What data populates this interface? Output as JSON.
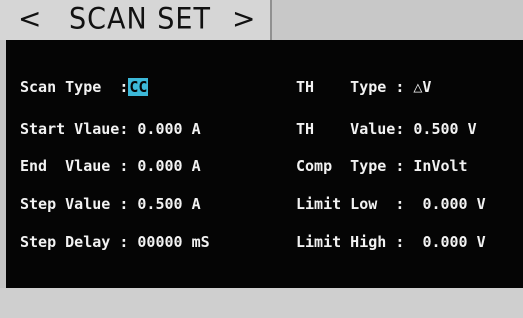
{
  "header": {
    "prev_symbol": "<",
    "title": "SCAN SET",
    "next_symbol": ">"
  },
  "left_rows": [
    {
      "label": "Scan Type  :",
      "value": "CC",
      "highlighted": true
    },
    {
      "label": "Start Vlaue: ",
      "value": "0.000 A",
      "highlighted": false
    },
    {
      "label": "End  Vlaue : ",
      "value": "0.000 A",
      "highlighted": false
    },
    {
      "label": "Step Value : ",
      "value": "0.500 A",
      "highlighted": false
    },
    {
      "label": "Step Delay : ",
      "value": "00000 mS",
      "highlighted": false
    }
  ],
  "right_rows": [
    {
      "label": "TH    Type : ",
      "value": "△V"
    },
    {
      "label": "TH    Value: ",
      "value": "0.500 V"
    },
    {
      "label": "Comp  Type : ",
      "value": "InVolt"
    },
    {
      "label": "Limit Low  :  ",
      "value": "0.000 V"
    },
    {
      "label": "Limit High :  ",
      "value": "0.000 V"
    }
  ],
  "colors": {
    "panel_background": "#050505",
    "text": "#f2f2f2",
    "highlight": "#3cb8d8",
    "header_background": "#d6d6d6"
  }
}
